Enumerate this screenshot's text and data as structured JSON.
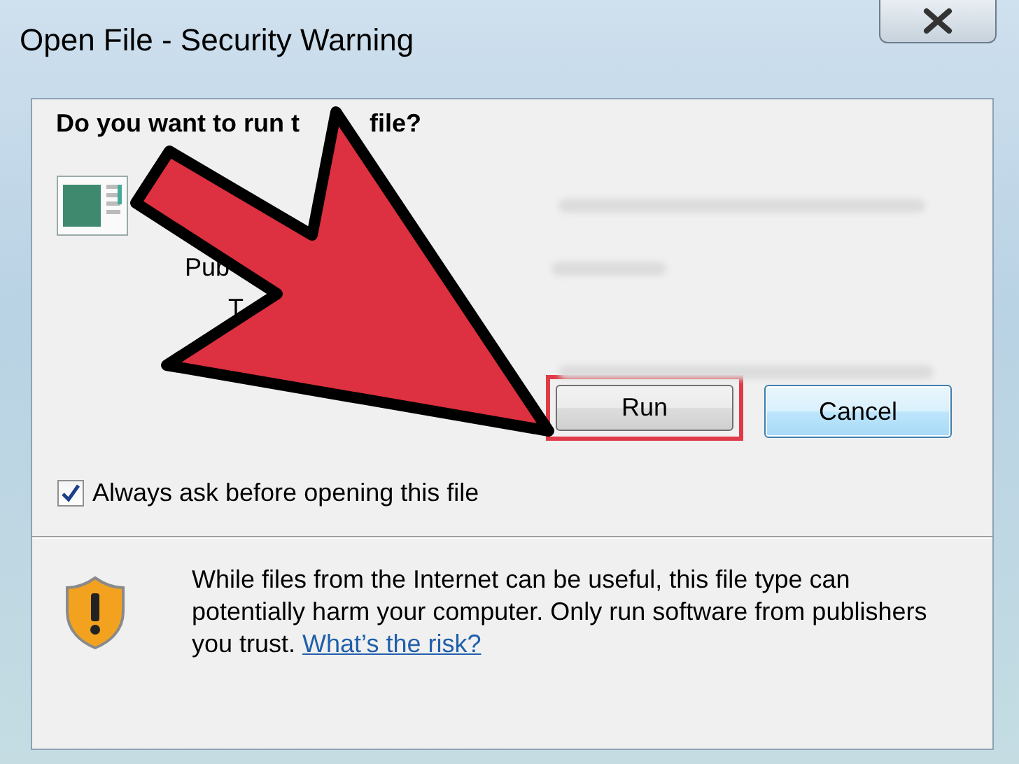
{
  "window": {
    "title": "Open File - Security Warning"
  },
  "heading_parts": [
    "Do you want to run t",
    "file?"
  ],
  "file_details": {
    "labels": [
      "Pub",
      "T"
    ]
  },
  "buttons": [
    {
      "label": "Run",
      "highlighted": true,
      "focused": false
    },
    {
      "label": "Cancel",
      "highlighted": false,
      "focused": true
    }
  ],
  "always_ask": {
    "label": "Always ask before opening this file",
    "checked": true
  },
  "warning": {
    "text": "While files from the Internet can be useful, this file type can potentially harm your computer. Only run software from publishers you trust.",
    "link": "What’s the risk?"
  }
}
